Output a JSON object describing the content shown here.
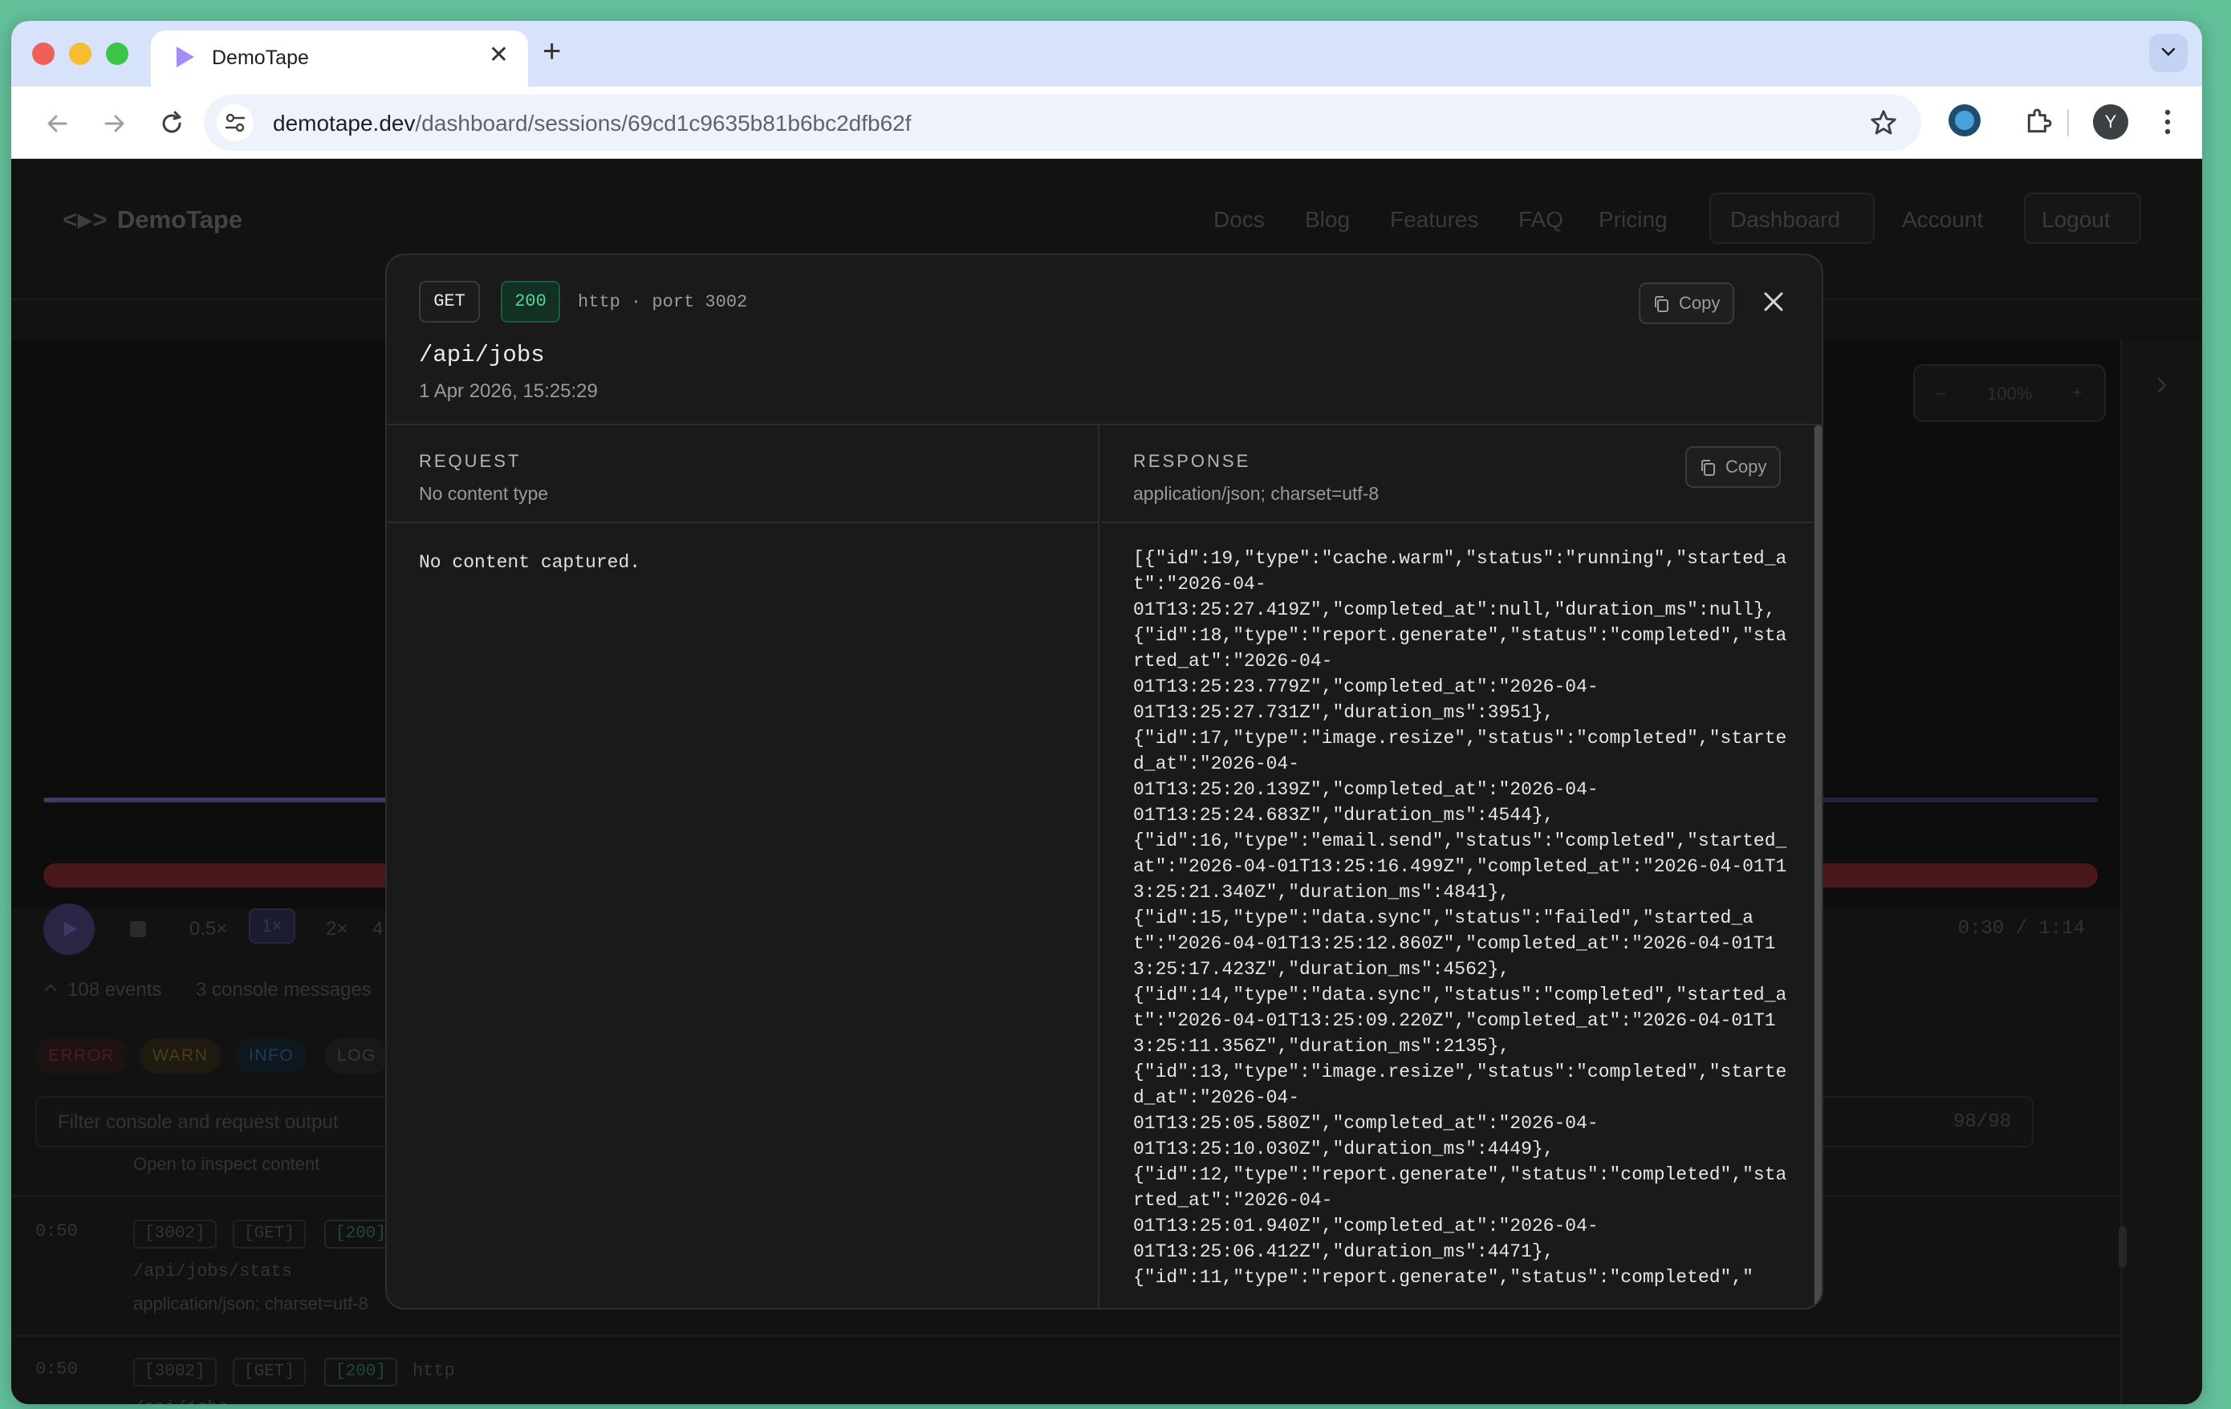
{
  "browser": {
    "tab_title": "DemoTape",
    "url_host": "demotape.dev",
    "url_path": "/dashboard/sessions/69cd1c9635b81b6bc2dfb62f",
    "avatar_letter": "Y"
  },
  "site": {
    "logo_mark": "<▶>",
    "logo_text": "DemoTape",
    "nav": [
      "Docs",
      "Blog",
      "Features",
      "FAQ",
      "Pricing",
      "Dashboard",
      "Account",
      "Logout"
    ]
  },
  "player": {
    "zoom_minus": "−",
    "zoom_level": "100%",
    "zoom_plus": "+",
    "speeds": [
      "0.5×",
      "1×",
      "2×",
      "4"
    ],
    "timecode": "0:30 / 1:14",
    "events_count": "108 events",
    "console_count": "3 console messages",
    "filters": [
      "ERROR",
      "WARN",
      "INFO",
      "LOG"
    ],
    "filter_placeholder": "Filter console and request output",
    "filter_count": "98/98"
  },
  "log_rows": [
    {
      "hint": "Open to inspect content"
    },
    {
      "time": "0:50",
      "port": "[3002]",
      "method": "[GET]",
      "status": "[200]",
      "path": "/api/jobs/stats",
      "content_type": "application/json; charset=utf-8"
    },
    {
      "time": "0:50",
      "port": "[3002]",
      "method": "[GET]",
      "status": "[200]",
      "proto": "http",
      "path": "/api/jobs"
    }
  ],
  "modal": {
    "method": "GET",
    "status": "200",
    "protocol": "http · port 3002",
    "copy_label": "Copy",
    "path": "/api/jobs",
    "timestamp": "1 Apr 2026, 15:25:29",
    "request": {
      "title": "REQUEST",
      "content_type": "No content type",
      "body": "No content captured."
    },
    "response": {
      "title": "RESPONSE",
      "content_type": "application/json; charset=utf-8",
      "copy_label": "Copy",
      "body": "[{\"id\":19,\"type\":\"cache.warm\",\"status\":\"running\",\"started_at\":\"2026-04-\n01T13:25:27.419Z\",\"completed_at\":null,\"duration_ms\":null},\n{\"id\":18,\"type\":\"report.generate\",\"status\":\"completed\",\"started_at\":\"2026-04-\n01T13:25:23.779Z\",\"completed_at\":\"2026-04-\n01T13:25:27.731Z\",\"duration_ms\":3951},\n{\"id\":17,\"type\":\"image.resize\",\"status\":\"completed\",\"started_at\":\"2026-04-\n01T13:25:20.139Z\",\"completed_at\":\"2026-04-\n01T13:25:24.683Z\",\"duration_ms\":4544},\n{\"id\":16,\"type\":\"email.send\",\"status\":\"completed\",\"started_at\":\"2026-04-01T13:25:16.499Z\",\"completed_at\":\"2026-04-01T13:25:21.340Z\",\"duration_ms\":4841},\n{\"id\":15,\"type\":\"data.sync\",\"status\":\"failed\",\"started_at\":\"2026-04-01T13:25:12.860Z\",\"completed_at\":\"2026-04-01T13:25:17.423Z\",\"duration_ms\":4562},\n{\"id\":14,\"type\":\"data.sync\",\"status\":\"completed\",\"started_at\":\"2026-04-01T13:25:09.220Z\",\"completed_at\":\"2026-04-01T13:25:11.356Z\",\"duration_ms\":2135},\n{\"id\":13,\"type\":\"image.resize\",\"status\":\"completed\",\"started_at\":\"2026-04-\n01T13:25:05.580Z\",\"completed_at\":\"2026-04-\n01T13:25:10.030Z\",\"duration_ms\":4449},\n{\"id\":12,\"type\":\"report.generate\",\"status\":\"completed\",\"started_at\":\"2026-04-\n01T13:25:01.940Z\",\"completed_at\":\"2026-04-\n01T13:25:06.412Z\",\"duration_ms\":4471},\n{\"id\":11,\"type\":\"report.generate\",\"status\":\"completed\",\""
    }
  }
}
